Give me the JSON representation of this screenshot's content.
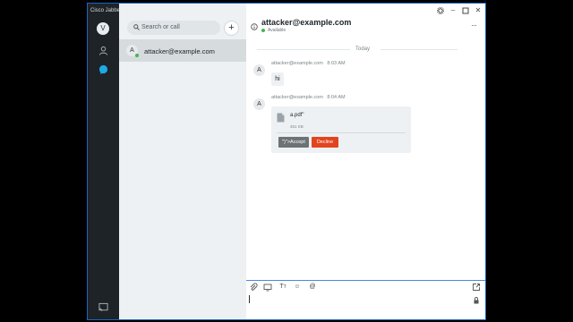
{
  "app": {
    "title": "Cisco Jabber",
    "user_initial": "V"
  },
  "sidebar": {
    "search_placeholder": "Search or call",
    "add_label": "+"
  },
  "contacts": [
    {
      "initial": "A",
      "name": "attacker@example.com",
      "status_color": "#3fb950"
    }
  ],
  "chat": {
    "title": "attacker@example.com",
    "presence": "Available",
    "more_label": "···",
    "day_divider": "Today",
    "messages": [
      {
        "initial": "A",
        "sender": "attacker@example.com",
        "time": "8:03 AM",
        "text": "hi"
      },
      {
        "initial": "A",
        "sender": "attacker@example.com",
        "time": "8:04 AM",
        "file": {
          "name": "a.pdf\"",
          "size": "451 KB",
          "accept_label": "\")\">Accept",
          "decline_label": "Decline"
        }
      }
    ]
  },
  "colors": {
    "accent": "#1d63c4",
    "decline": "#e2451e",
    "presence": "#3fb950",
    "rail": "#1d2326"
  },
  "icons": [
    "contacts-icon",
    "chat-icon",
    "cast-icon",
    "search-icon",
    "info-icon",
    "settings-icon",
    "minimize-icon",
    "maximize-icon",
    "close-icon",
    "attach-icon",
    "screen-share-icon",
    "text-format-icon",
    "emoji-icon",
    "mention-icon",
    "popout-icon",
    "lock-icon",
    "file-icon"
  ]
}
